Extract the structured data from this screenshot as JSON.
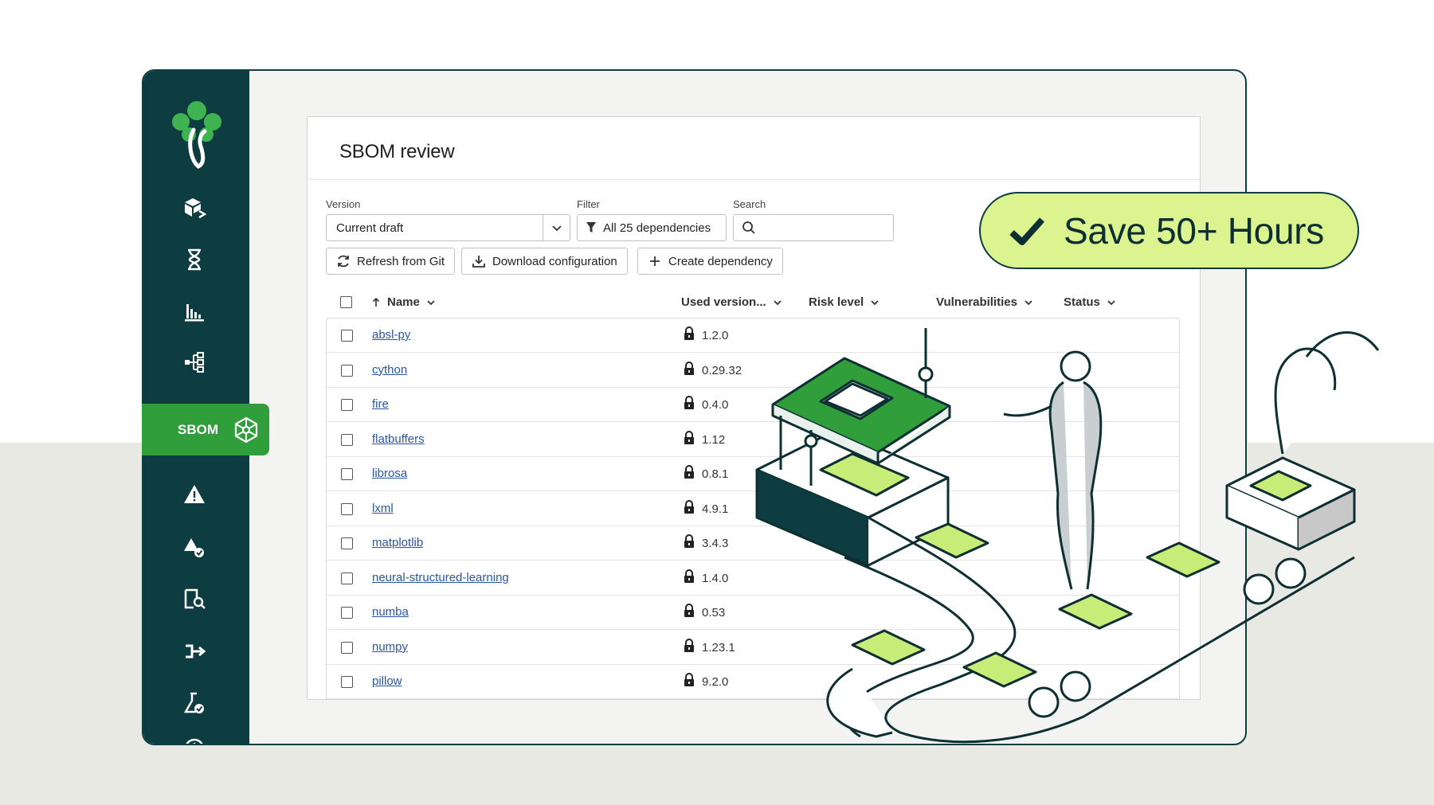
{
  "sidebar": {
    "active_item": {
      "label": "SBOM",
      "icon": "sbom-network-icon"
    },
    "items": [
      {
        "icon": "packages-icon"
      },
      {
        "icon": "hourglass-icon"
      },
      {
        "icon": "bar-chart-icon"
      },
      {
        "icon": "hierarchy-icon"
      },
      {
        "icon": "sbom-network-icon",
        "label": "SBOM",
        "active": true
      },
      {
        "icon": "warning-icon"
      },
      {
        "icon": "alert-check-icon"
      },
      {
        "icon": "document-search-icon"
      },
      {
        "icon": "merge-arrow-icon"
      },
      {
        "icon": "flask-check-icon"
      },
      {
        "icon": "clock-icon"
      }
    ],
    "colors": {
      "background": "#0d3d40",
      "active": "#2f9e3b"
    }
  },
  "page": {
    "title": "SBOM review",
    "version": {
      "label": "Version",
      "value": "Current draft"
    },
    "filter": {
      "label": "Filter",
      "value": "All 25 dependencies"
    },
    "search": {
      "label": "Search",
      "value": ""
    },
    "buttons": {
      "refresh": "Refresh from Git",
      "download": "Download configuration",
      "create": "Create dependency"
    },
    "columns": {
      "name": "Name",
      "used_version": "Used version...",
      "risk_level": "Risk level",
      "vulnerabilities": "Vulnerabilities",
      "status": "Status"
    },
    "rows": [
      {
        "name": "absl-py",
        "version": "1.2.0"
      },
      {
        "name": "cython",
        "version": "0.29.32"
      },
      {
        "name": "fire",
        "version": "0.4.0"
      },
      {
        "name": "flatbuffers",
        "version": "1.12"
      },
      {
        "name": "librosa",
        "version": "0.8.1"
      },
      {
        "name": "lxml",
        "version": "4.9.1"
      },
      {
        "name": "matplotlib",
        "version": "3.4.3"
      },
      {
        "name": "neural-structured-learning",
        "version": "1.4.0"
      },
      {
        "name": "numba",
        "version": "0.53"
      },
      {
        "name": "numpy",
        "version": "1.23.1"
      },
      {
        "name": "pillow",
        "version": "9.2.0"
      }
    ]
  },
  "badge": {
    "text": "Save 50+ Hours",
    "icon": "checkmark-icon",
    "color": "#dbf490"
  }
}
